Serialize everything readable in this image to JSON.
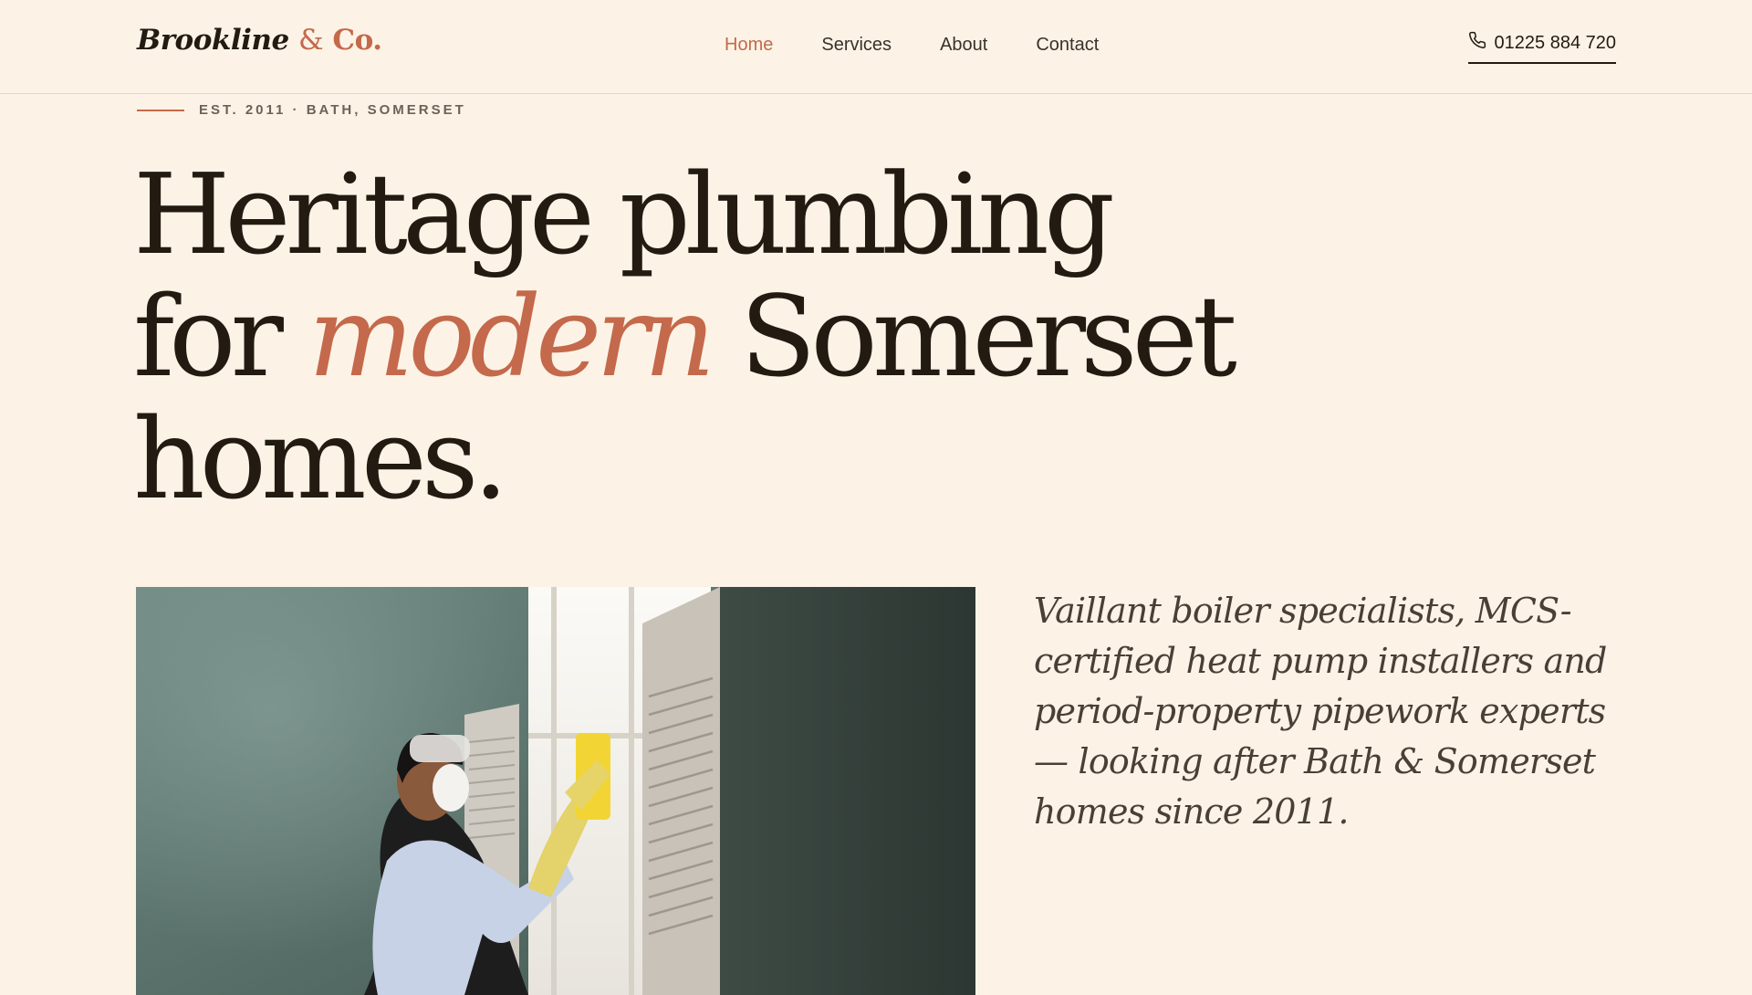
{
  "brand": {
    "name": "Brookline",
    "amp": "&",
    "co": "Co."
  },
  "nav": {
    "items": [
      {
        "label": "Home",
        "active": true
      },
      {
        "label": "Services",
        "active": false
      },
      {
        "label": "About",
        "active": false
      },
      {
        "label": "Contact",
        "active": false
      }
    ]
  },
  "phone": {
    "icon": "phone-icon",
    "number": "01225 884 720"
  },
  "hero": {
    "eyebrow": "EST. 2011 · BATH, SOMERSET",
    "headline_line1": "Heritage plumbing",
    "headline_line2_pre": "for ",
    "headline_line2_accent": "modern",
    "headline_line2_post": " Somerset",
    "headline_line3": "homes.",
    "intro": "Vaillant boiler specialists, MCS-certified heat pump installers and period-property pipework experts — looking after Bath & Somerset homes since 2011."
  },
  "colors": {
    "background": "#fcf3e6",
    "accent": "#c4694b",
    "ink": "#231b12"
  }
}
